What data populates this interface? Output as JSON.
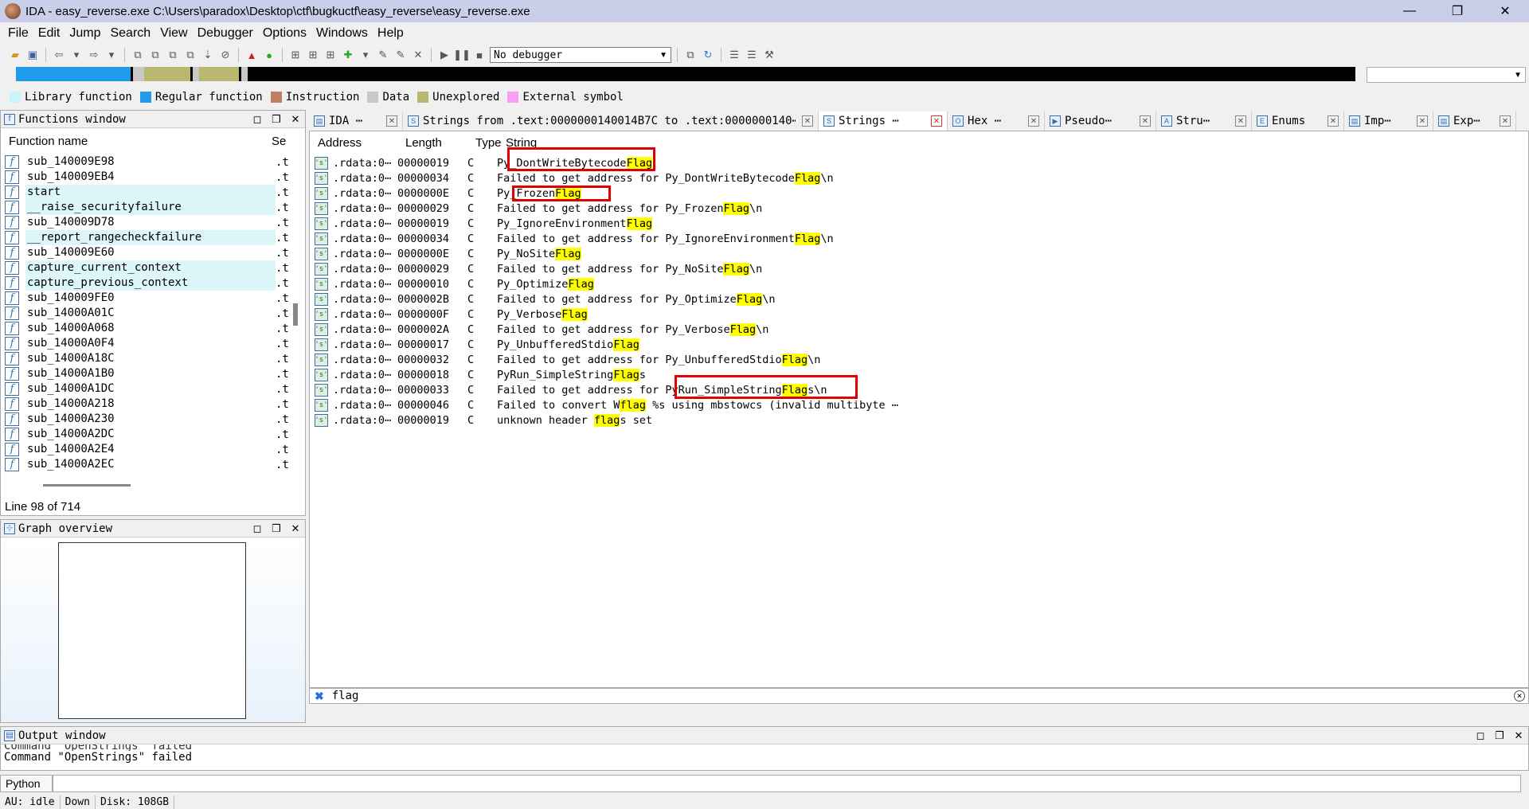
{
  "window": {
    "title": "IDA - easy_reverse.exe C:\\Users\\paradox\\Desktop\\ctf\\bugkuctf\\easy_reverse\\easy_reverse.exe",
    "minimize": "—",
    "maximize": "❐",
    "close": "✕"
  },
  "menu": [
    "File",
    "Edit",
    "Jump",
    "Search",
    "View",
    "Debugger",
    "Options",
    "Windows",
    "Help"
  ],
  "toolbar": {
    "debugger": "No debugger"
  },
  "legend": [
    {
      "label": "Library function",
      "color": "#c7f5fb"
    },
    {
      "label": "Regular function",
      "color": "#1f9bea"
    },
    {
      "label": "Instruction",
      "color": "#c08060"
    },
    {
      "label": "Data",
      "color": "#c8c8c8"
    },
    {
      "label": "Unexplored",
      "color": "#b8b870"
    },
    {
      "label": "External symbol",
      "color": "#f5a0f5"
    }
  ],
  "functions_window": {
    "title": "Functions window",
    "col_name": "Function name",
    "col_seg": "Se",
    "line_info": "Line 98 of 714",
    "items": [
      {
        "name": "sub_140009E98",
        "seg": ".t",
        "lib": false
      },
      {
        "name": "sub_140009EB4",
        "seg": ".t",
        "lib": false
      },
      {
        "name": "start",
        "seg": ".t",
        "lib": true
      },
      {
        "name": "__raise_securityfailure",
        "seg": ".t",
        "lib": true
      },
      {
        "name": "sub_140009D78",
        "seg": ".t",
        "lib": false
      },
      {
        "name": "__report_rangecheckfailure",
        "seg": ".t",
        "lib": true
      },
      {
        "name": "sub_140009E60",
        "seg": ".t",
        "lib": false
      },
      {
        "name": "capture_current_context",
        "seg": ".t",
        "lib": true
      },
      {
        "name": "capture_previous_context",
        "seg": ".t",
        "lib": true
      },
      {
        "name": "sub_140009FE0",
        "seg": ".t",
        "lib": false
      },
      {
        "name": "sub_14000A01C",
        "seg": ".t",
        "lib": false
      },
      {
        "name": "sub_14000A068",
        "seg": ".t",
        "lib": false
      },
      {
        "name": "sub_14000A0F4",
        "seg": ".t",
        "lib": false
      },
      {
        "name": "sub_14000A18C",
        "seg": ".t",
        "lib": false
      },
      {
        "name": "sub_14000A1B0",
        "seg": ".t",
        "lib": false
      },
      {
        "name": "sub_14000A1DC",
        "seg": ".t",
        "lib": false
      },
      {
        "name": "sub_14000A218",
        "seg": ".t",
        "lib": false
      },
      {
        "name": "sub_14000A230",
        "seg": ".t",
        "lib": false
      },
      {
        "name": "sub_14000A2DC",
        "seg": ".t",
        "lib": false
      },
      {
        "name": "sub_14000A2E4",
        "seg": ".t",
        "lib": false
      },
      {
        "name": "sub_14000A2EC",
        "seg": ".t",
        "lib": false
      }
    ]
  },
  "graph_overview": {
    "title": "Graph overview"
  },
  "tabs": [
    {
      "label": "IDA ⋯",
      "icon": "ida-view-icon",
      "active": false
    },
    {
      "label": "Strings from .text:0000000140014B7C to .text:0000000140⋯",
      "icon": "strings-icon",
      "active": false
    },
    {
      "label": "Strings ⋯",
      "icon": "strings-icon",
      "active": true
    },
    {
      "label": "Hex ⋯",
      "icon": "hex-icon",
      "active": false
    },
    {
      "label": "Pseudo⋯",
      "icon": "pseudocode-icon",
      "active": false
    },
    {
      "label": "Stru⋯",
      "icon": "structures-icon",
      "active": false
    },
    {
      "label": "Enums",
      "icon": "enums-icon",
      "active": false
    },
    {
      "label": "Imp⋯",
      "icon": "imports-icon",
      "active": false
    },
    {
      "label": "Exp⋯",
      "icon": "exports-icon",
      "active": false
    }
  ],
  "strings_window": {
    "col_address": "Address",
    "col_length": "Length",
    "col_type": "Type",
    "col_string": "String",
    "rows": [
      {
        "addr": ".rdata:0⋯",
        "len": "00000019",
        "type": "C",
        "pre": "Py_DontWriteBytecode",
        "hl": "Flag",
        "post": ""
      },
      {
        "addr": ".rdata:0⋯",
        "len": "00000034",
        "type": "C",
        "pre": "Failed to get address for Py_DontWriteBytecode",
        "hl": "Flag",
        "post": "\\n"
      },
      {
        "addr": ".rdata:0⋯",
        "len": "0000000E",
        "type": "C",
        "pre": "Py_Frozen",
        "hl": "Flag",
        "post": ""
      },
      {
        "addr": ".rdata:0⋯",
        "len": "00000029",
        "type": "C",
        "pre": "Failed to get address for Py_Frozen",
        "hl": "Flag",
        "post": "\\n"
      },
      {
        "addr": ".rdata:0⋯",
        "len": "00000019",
        "type": "C",
        "pre": "Py_IgnoreEnvironment",
        "hl": "Flag",
        "post": ""
      },
      {
        "addr": ".rdata:0⋯",
        "len": "00000034",
        "type": "C",
        "pre": "Failed to get address for Py_IgnoreEnvironment",
        "hl": "Flag",
        "post": "\\n"
      },
      {
        "addr": ".rdata:0⋯",
        "len": "0000000E",
        "type": "C",
        "pre": "Py_NoSite",
        "hl": "Flag",
        "post": ""
      },
      {
        "addr": ".rdata:0⋯",
        "len": "00000029",
        "type": "C",
        "pre": "Failed to get address for Py_NoSite",
        "hl": "Flag",
        "post": "\\n"
      },
      {
        "addr": ".rdata:0⋯",
        "len": "00000010",
        "type": "C",
        "pre": "Py_Optimize",
        "hl": "Flag",
        "post": ""
      },
      {
        "addr": ".rdata:0⋯",
        "len": "0000002B",
        "type": "C",
        "pre": "Failed to get address for Py_Optimize",
        "hl": "Flag",
        "post": "\\n"
      },
      {
        "addr": ".rdata:0⋯",
        "len": "0000000F",
        "type": "C",
        "pre": "Py_Verbose",
        "hl": "Flag",
        "post": ""
      },
      {
        "addr": ".rdata:0⋯",
        "len": "0000002A",
        "type": "C",
        "pre": "Failed to get address for Py_Verbose",
        "hl": "Flag",
        "post": "\\n"
      },
      {
        "addr": ".rdata:0⋯",
        "len": "00000017",
        "type": "C",
        "pre": "Py_UnbufferedStdio",
        "hl": "Flag",
        "post": ""
      },
      {
        "addr": ".rdata:0⋯",
        "len": "00000032",
        "type": "C",
        "pre": "Failed to get address for Py_UnbufferedStdio",
        "hl": "Flag",
        "post": "\\n"
      },
      {
        "addr": ".rdata:0⋯",
        "len": "00000018",
        "type": "C",
        "pre": "PyRun_SimpleString",
        "hl": "Flag",
        "post": "s"
      },
      {
        "addr": ".rdata:0⋯",
        "len": "00000033",
        "type": "C",
        "pre": "Failed to get address for PyRun_SimpleString",
        "hl": "Flag",
        "post": "s\\n"
      },
      {
        "addr": ".rdata:0⋯",
        "len": "00000046",
        "type": "C",
        "pre": "Failed to convert W",
        "hl": "flag",
        "post": " %s using mbstowcs (invalid multibyte ⋯"
      },
      {
        "addr": ".rdata:0⋯",
        "len": "00000019",
        "type": "C",
        "pre": "unknown header ",
        "hl": "flag",
        "post": "s set"
      }
    ]
  },
  "filter": {
    "text": "flag"
  },
  "output_window": {
    "title": "Output window",
    "lines": [
      "Command \"OpenStrings\" failed",
      "Command \"OpenStrings\" failed"
    ]
  },
  "python": {
    "label": "Python"
  },
  "status": {
    "au": "AU:  idle",
    "dir": "Down",
    "disk": "Disk: 108GB"
  }
}
